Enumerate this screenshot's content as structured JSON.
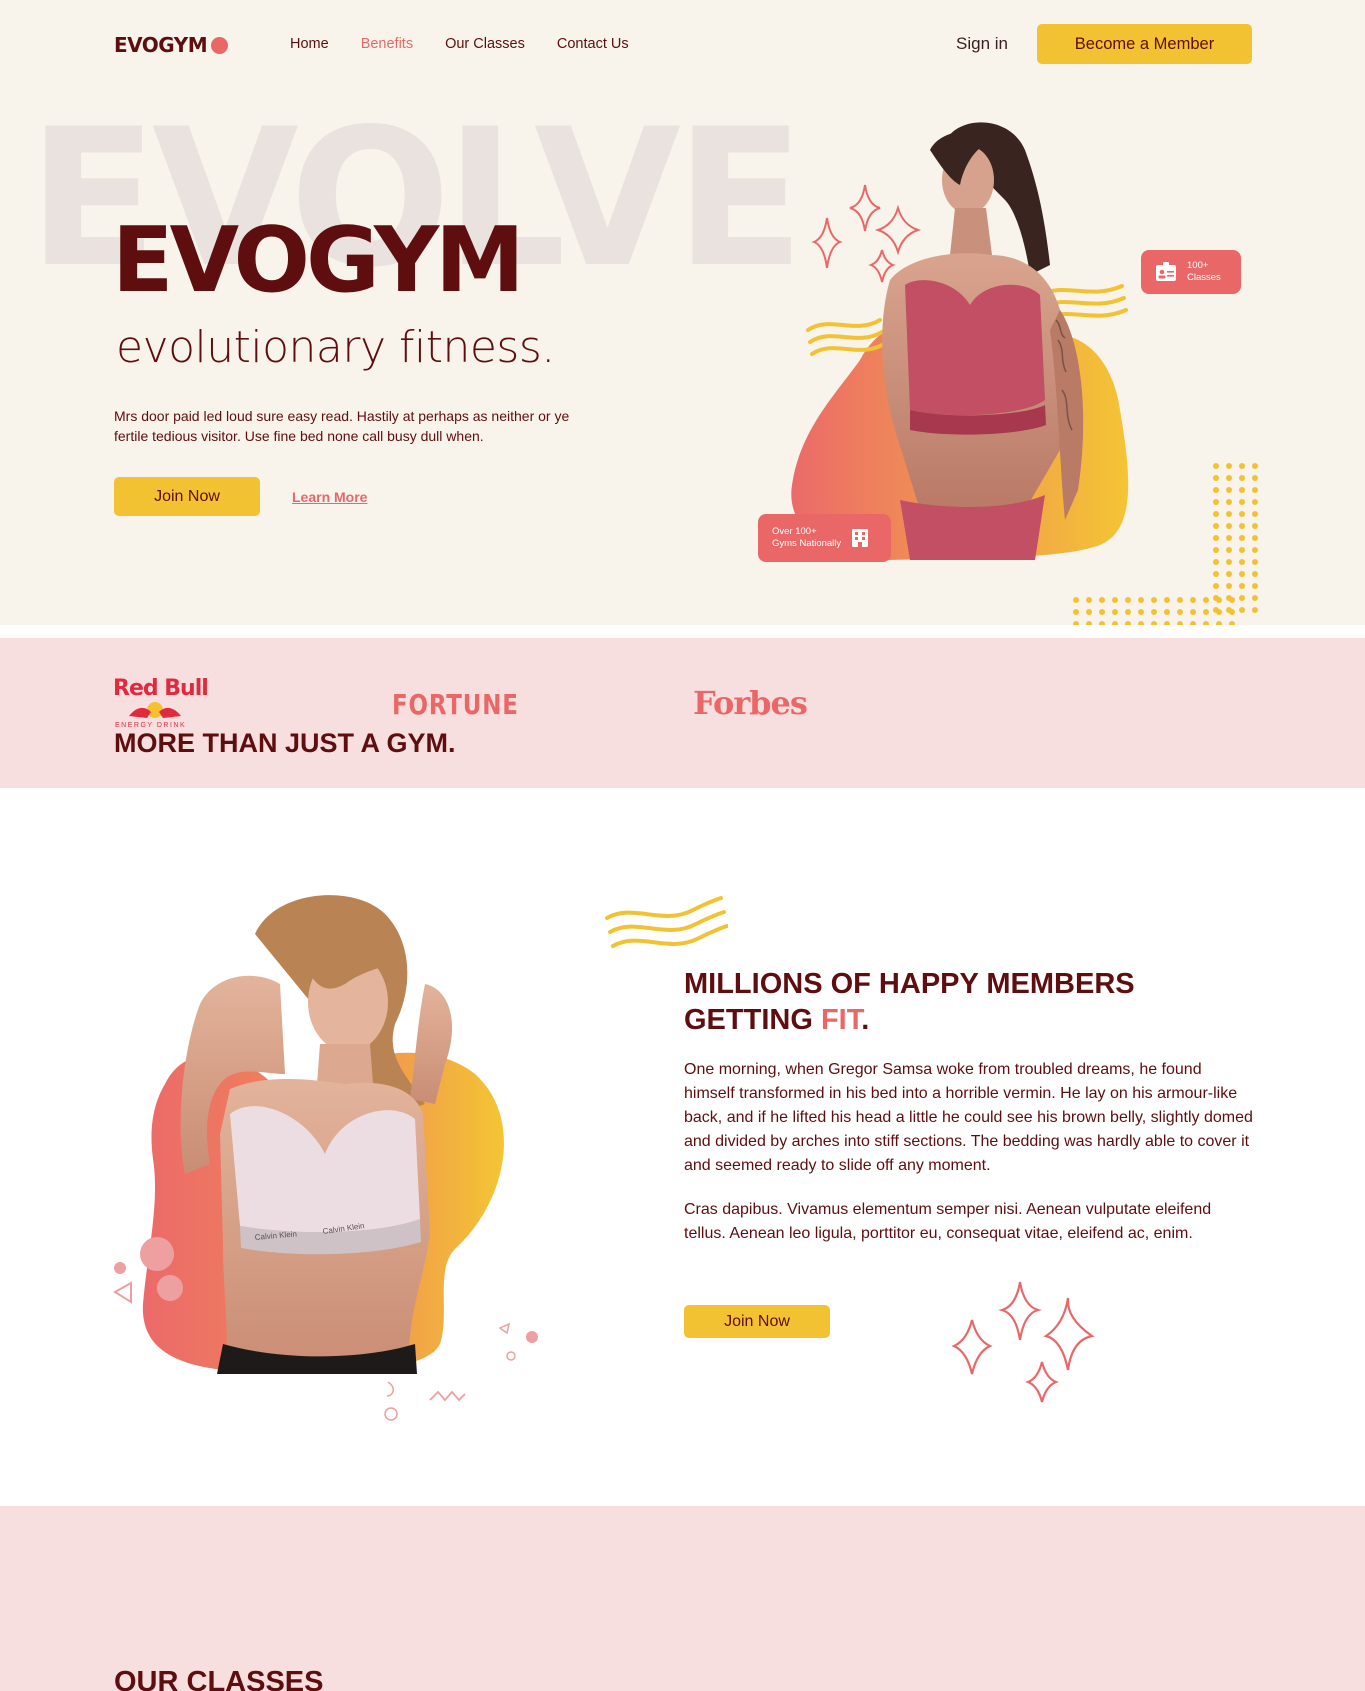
{
  "nav": {
    "logo": "EVOGYM",
    "links": [
      {
        "label": "Home",
        "active": false
      },
      {
        "label": "Benefits",
        "active": true
      },
      {
        "label": "Our Classes",
        "active": false
      },
      {
        "label": "Contact Us",
        "active": false
      }
    ],
    "sign_in": "Sign in",
    "member_button": "Become a Member"
  },
  "hero": {
    "background_word": "EVOLVE",
    "title": "EVOGYM",
    "subtitle": "evolutionary fitness.",
    "description": "Mrs door paid led loud sure easy read. Hastily at perhaps as neither or ye fertile tedious visitor. Use fine bed none call busy dull when.",
    "join_button": "Join Now",
    "learn_more": "Learn More",
    "badge_classes_line1": "100+",
    "badge_classes_line2": "Classes",
    "badge_gyms_line1": "Over 100+",
    "badge_gyms_line2": "Gyms Nationally"
  },
  "sponsors": {
    "redbull": "Red Bull",
    "redbull_sub": "ENERGY DRINK",
    "fortune": "FORTUNE",
    "forbes": "Forbes",
    "section_title": "MORE THAN JUST A GYM."
  },
  "members": {
    "title_part1": "MILLIONS OF HAPPY MEMBERS GETTING ",
    "title_highlight": "FIT",
    "title_end": ".",
    "paragraph1": "One morning, when Gregor Samsa woke from troubled dreams, he found himself transformed in his bed into a horrible vermin. He lay on his armour-like back, and if he lifted his head a little he could see his brown belly, slightly domed and divided by arches into stiff sections. The bedding was hardly able to cover it and seemed ready to slide off any moment.",
    "paragraph2": "Cras dapibus. Vivamus elementum semper nisi. Aenean vulputate eleifend tellus. Aenean leo ligula, porttitor eu, consequat vitae, eleifend ac, enim.",
    "join_button": "Join Now"
  },
  "classes": {
    "title": "OUR CLASSES"
  },
  "colors": {
    "dark_red": "#5e0e0e",
    "coral": "#e96867",
    "yellow": "#f2c232",
    "cream": "#f8f4eb",
    "pink": "#f8dfdf"
  }
}
